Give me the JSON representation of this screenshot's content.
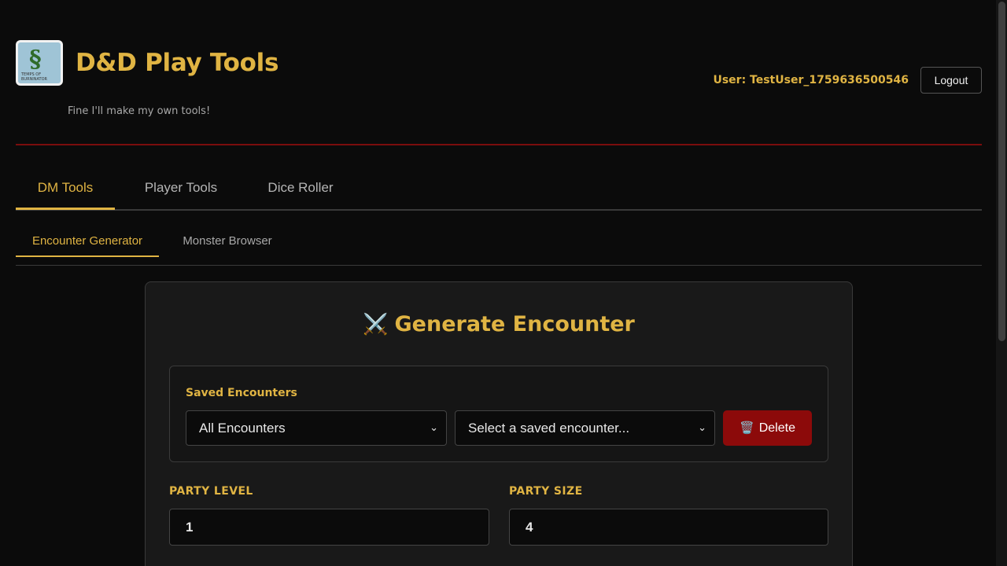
{
  "header": {
    "logo_text": "TEMPS OF BURNINATOR",
    "title": "D&D Play Tools",
    "subtitle": "Fine I'll make my own tools!",
    "user_label": "User: TestUser_1759636500546",
    "logout_label": "Logout"
  },
  "main_tabs": [
    {
      "label": "DM Tools",
      "active": true
    },
    {
      "label": "Player Tools",
      "active": false
    },
    {
      "label": "Dice Roller",
      "active": false
    }
  ],
  "sub_tabs": [
    {
      "label": "Encounter Generator",
      "active": true
    },
    {
      "label": "Monster Browser",
      "active": false
    }
  ],
  "card": {
    "icon": "crossed-swords-icon",
    "title": "Generate Encounter",
    "saved": {
      "label": "Saved Encounters",
      "filter_value": "All Encounters",
      "select_placeholder": "Select a saved encounter...",
      "delete_label": "Delete"
    },
    "party_level": {
      "label": "PARTY LEVEL",
      "value": "1"
    },
    "party_size": {
      "label": "PARTY SIZE",
      "value": "4"
    }
  },
  "colors": {
    "accent": "#e0b443",
    "danger": "#8c0a0a",
    "header_rule": "#7a0d0d",
    "background": "#0b0b0b"
  }
}
